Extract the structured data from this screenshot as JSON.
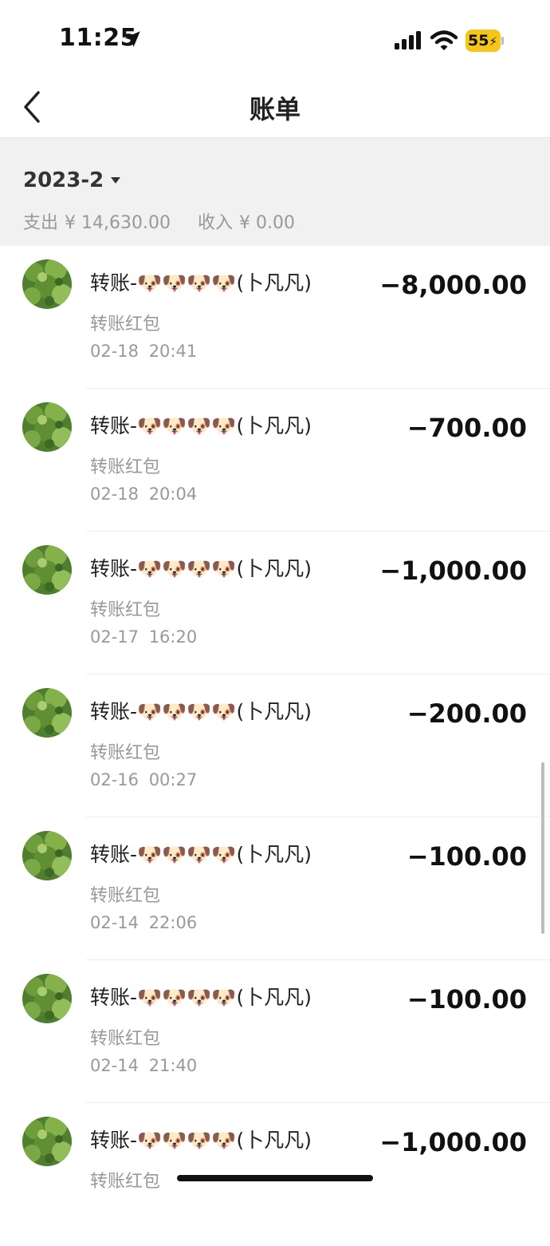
{
  "status_bar": {
    "time": "11:25",
    "battery": "55"
  },
  "nav": {
    "title": "账单"
  },
  "summary": {
    "month": "2023-2",
    "expense_label": "支出",
    "expense_value": "¥ 14,630.00",
    "income_label": "收入",
    "income_value": "¥ 0.00"
  },
  "records": [
    {
      "title": "转账-🐶🐶🐶🐶(卜凡凡)",
      "type": "转账红包",
      "time": "02-18 20:41",
      "amount": "−8,000.00"
    },
    {
      "title": "转账-🐶🐶🐶🐶(卜凡凡)",
      "type": "转账红包",
      "time": "02-18 20:04",
      "amount": "−700.00"
    },
    {
      "title": "转账-🐶🐶🐶🐶(卜凡凡)",
      "type": "转账红包",
      "time": "02-17 16:20",
      "amount": "−1,000.00"
    },
    {
      "title": "转账-🐶🐶🐶🐶(卜凡凡)",
      "type": "转账红包",
      "time": "02-16 00:27",
      "amount": "−200.00"
    },
    {
      "title": "转账-🐶🐶🐶🐶(卜凡凡)",
      "type": "转账红包",
      "time": "02-14 22:06",
      "amount": "−100.00"
    },
    {
      "title": "转账-🐶🐶🐶🐶(卜凡凡)",
      "type": "转账红包",
      "time": "02-14 21:40",
      "amount": "−100.00"
    },
    {
      "title": "转账-🐶🐶🐶🐶(卜凡凡)",
      "type": "转账红包",
      "time": "",
      "amount": "−1,000.00"
    }
  ],
  "colors": {
    "battery": "#f5c518",
    "summary_bg": "#f1f1f1",
    "secondary_text": "#999999"
  },
  "icons": [
    "location-arrow-icon",
    "cellular-signal-icon",
    "wifi-icon",
    "battery-icon",
    "back-chevron-icon",
    "caret-down-icon",
    "avatar-tree-icon"
  ]
}
